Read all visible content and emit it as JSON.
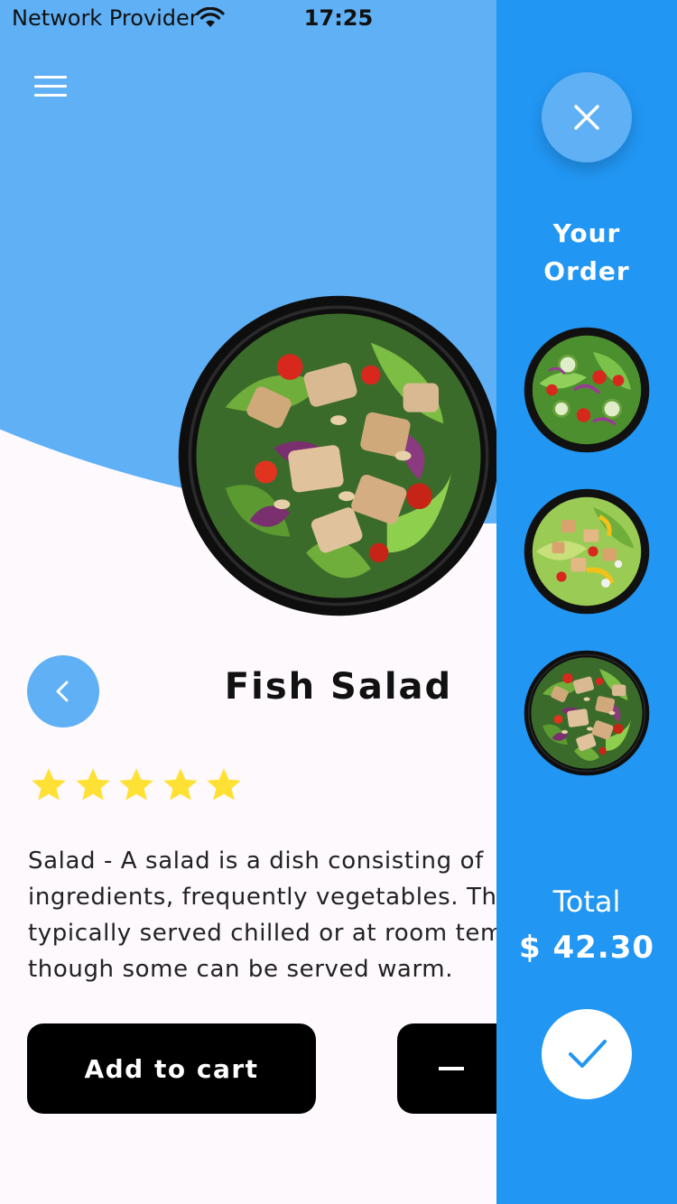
{
  "status_bar": {
    "carrier": "Network Provider",
    "time": "17:25",
    "wifi_icon": "wifi-icon",
    "battery_icon": "battery-icon"
  },
  "header": {
    "menu_icon": "hamburger-menu-icon"
  },
  "dish": {
    "name": "Fish Salad",
    "rating": 5,
    "rating_max": 5,
    "description": "Salad -  A salad is a dish consisting of\ningredients, frequently vegetables. Th\ntypically served chilled or at room tem\nthough some can be served warm.",
    "image": "chicken-salad-bowl"
  },
  "actions": {
    "add_to_cart_label": "Add to cart",
    "decrease_icon": "minus-icon",
    "back_icon": "chevron-left-icon"
  },
  "order_panel": {
    "title": "Your\nOrder",
    "close_icon": "close-icon",
    "items": [
      {
        "image": "garden-salad-bowl"
      },
      {
        "image": "chef-salad-bowl"
      },
      {
        "image": "chicken-salad-bowl"
      }
    ],
    "total_label": "Total",
    "total_amount": "$ 42.30",
    "confirm_icon": "checkmark-icon"
  },
  "colors": {
    "header_blue": "#5fb0f5",
    "panel_blue": "#2196f3",
    "star_yellow": "#ffe135",
    "button_black": "#000000",
    "background": "#fdf9fd"
  }
}
